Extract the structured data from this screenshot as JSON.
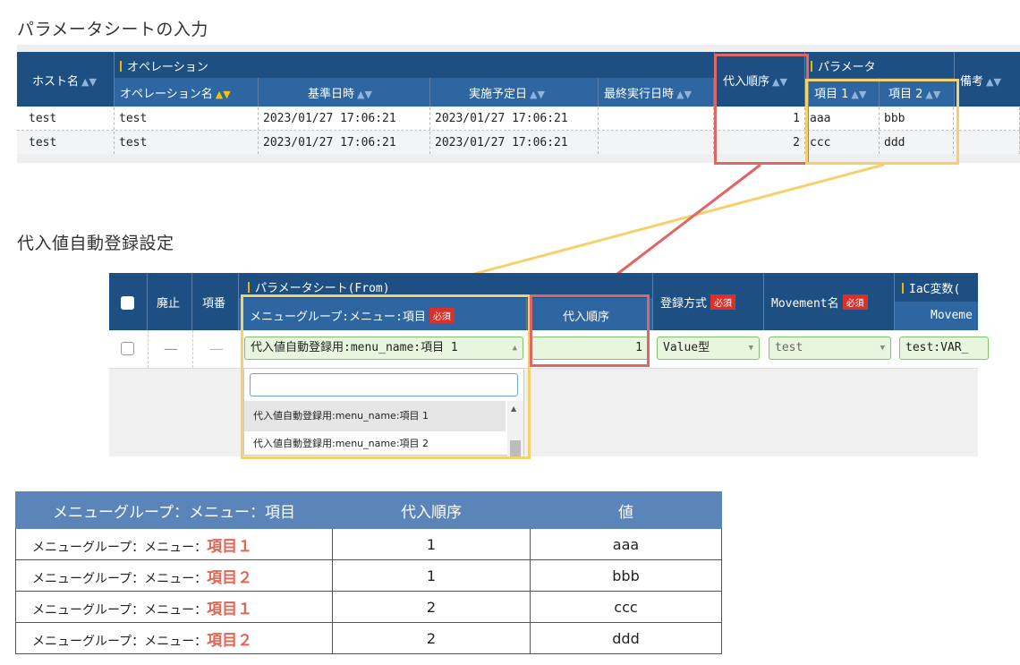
{
  "section1_title": "パラメータシートの入力",
  "section2_title": "代入値自動登録設定",
  "param_table": {
    "headers": {
      "host": "ホスト名",
      "operation_group": "オペレーション",
      "operation_name": "オペレーション名",
      "base_datetime": "基準日時",
      "scheduled_date": "実施予定日",
      "last_exec": "最終実行日時",
      "order": "代入順序",
      "param_group": "パラメータ",
      "item1": "項目 1",
      "item2": "項目 2",
      "notes": "備考"
    },
    "sort_glyph": "▲▼",
    "rows": [
      {
        "host": "test",
        "op": "test",
        "base": "2023/01/27 17:06:21",
        "sched": "2023/01/27 17:06:21",
        "last": "",
        "order": "1",
        "item1": "aaa",
        "item2": "bbb"
      },
      {
        "host": "test",
        "op": "test",
        "base": "2023/01/27 17:06:21",
        "sched": "2023/01/27 17:06:21",
        "last": "",
        "order": "2",
        "item1": "ccc",
        "item2": "ddd"
      }
    ]
  },
  "reg_table": {
    "headers": {
      "discard": "廃止",
      "item_no": "項番",
      "param_sheet_from": "パラメータシート(From)",
      "menu_item": "メニューグループ:メニュー:項目",
      "order": "代入順序",
      "reg_method": "登録方式",
      "movement_name": "Movement名",
      "iac_var": "IaC変数(",
      "movement_sub": "Moveme"
    },
    "required_badge": "必須",
    "row": {
      "discard": "—",
      "item_no": "—",
      "menu_item_value": "代入値自動登録用:menu_name:項目 1",
      "order_value": "1",
      "reg_method_value": "Value型",
      "movement_value": "test",
      "iac_value": "test:VAR_"
    },
    "dropdown": {
      "search_value": "",
      "options": [
        "代入値自動登録用:menu_name:項目 1",
        "代入値自動登録用:menu_name:項目 2"
      ]
    }
  },
  "summary_table": {
    "headers": [
      "メニューグループ：メニュー：項目",
      "代入順序",
      "値"
    ],
    "prefix": "メニューグループ：メニュー：",
    "rows": [
      {
        "item": "項目１",
        "order": "1",
        "value": "aaa"
      },
      {
        "item": "項目２",
        "order": "1",
        "value": "bbb"
      },
      {
        "item": "項目１",
        "order": "2",
        "value": "ccc"
      },
      {
        "item": "項目２",
        "order": "2",
        "value": "ddd"
      }
    ]
  },
  "colors": {
    "header_blue": "#1e4f83",
    "highlight_red": "#e06666",
    "highlight_yellow": "#f5d16c",
    "summary_header": "#5b85b8",
    "emphasis": "#e06655"
  }
}
